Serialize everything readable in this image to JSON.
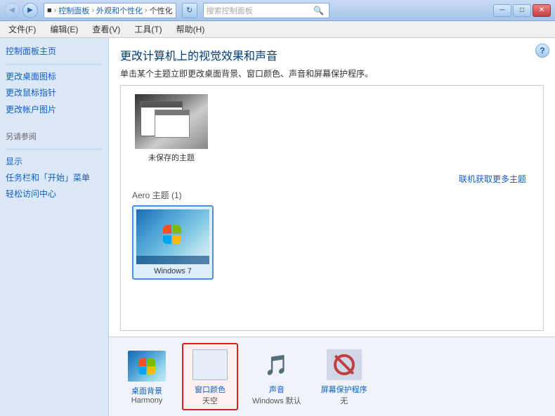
{
  "titlebar": {
    "icon_label": "CP",
    "address": {
      "root": "■",
      "sep1": "›",
      "part1": "控制面板",
      "sep2": "›",
      "part2": "外观和个性化",
      "sep3": "›",
      "part3": "个性化"
    },
    "search_placeholder": "搜索控制面板",
    "minimize_label": "─",
    "maximize_label": "□",
    "close_label": "✕"
  },
  "menubar": {
    "items": [
      {
        "label": "文件(F)"
      },
      {
        "label": "编辑(E)"
      },
      {
        "label": "查看(V)"
      },
      {
        "label": "工具(T)"
      },
      {
        "label": "帮助(H)"
      }
    ]
  },
  "sidebar": {
    "nav_links": [
      {
        "label": "控制面板主页"
      },
      {
        "label": "更改桌面图标"
      },
      {
        "label": "更改鼠标指针"
      },
      {
        "label": "更改帐户图片"
      }
    ],
    "section_title": "另请参阅",
    "see_also_links": [
      {
        "label": "显示"
      },
      {
        "label": "任务栏和「开始」菜单"
      },
      {
        "label": "轻松访问中心"
      }
    ]
  },
  "content": {
    "title": "更改计算机上的视觉效果和声音",
    "subtitle": "单击某个主题立即更改桌面背景、窗口颜色、声音和屏幕保护程序。",
    "get_more_link": "联机获取更多主题",
    "unsaved_section_label": "",
    "unsaved_theme_name": "未保存的主题",
    "aero_section_label": "Aero 主题 (1)",
    "win7_theme_name": "Windows 7",
    "bottom_items": [
      {
        "label": "桌面背景",
        "sublabel": "Harmony",
        "icon_type": "desktop"
      },
      {
        "label": "窗口颜色",
        "sublabel": "天空",
        "icon_type": "window",
        "selected": true
      },
      {
        "label": "声音",
        "sublabel": "Windows 默认",
        "icon_type": "sound"
      },
      {
        "label": "屏幕保护程序",
        "sublabel": "无",
        "icon_type": "screensaver"
      }
    ]
  }
}
